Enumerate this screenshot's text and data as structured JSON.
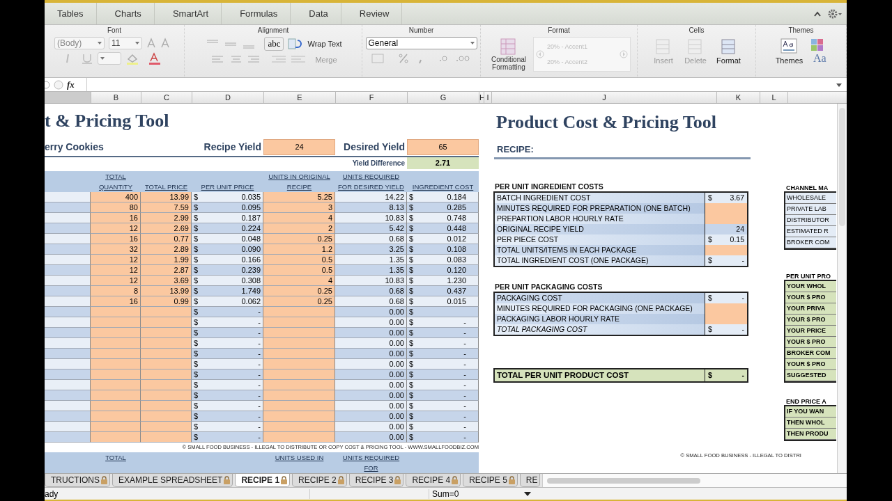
{
  "ribbon": {
    "tabs": [
      "Tables",
      "Charts",
      "SmartArt",
      "Formulas",
      "Data",
      "Review"
    ],
    "font_group": {
      "label": "Font",
      "font_name": "(Body)",
      "font_size": "11"
    },
    "alignment_group": {
      "label": "Alignment",
      "orientation_button": "abc",
      "wrap_text": "Wrap Text",
      "merge": "Merge"
    },
    "number_group": {
      "label": "Number",
      "format": "General"
    },
    "format_group": {
      "label": "Format",
      "conditional_formatting": "Conditional Formatting",
      "styles": [
        "20% - Accent1",
        "20% - Accent2"
      ]
    },
    "cells_group": {
      "label": "Cells",
      "buttons": [
        {
          "label": "Insert",
          "disabled": true
        },
        {
          "label": "Delete",
          "disabled": true
        },
        {
          "label": "Format",
          "disabled": false
        }
      ]
    },
    "themes_group": {
      "label": "Themes",
      "themes_button": "Themes",
      "fonts_button": "Aa"
    }
  },
  "formula_bar": {
    "fx": "fx"
  },
  "column_headers": [
    "B",
    "C",
    "D",
    "E",
    "F",
    "G",
    "H",
    "I",
    "J",
    "K",
    "L"
  ],
  "left_sheet": {
    "title": "t & Pricing Tool",
    "recipe_name": "erry Cookies",
    "recipe_yield_label": "Recipe Yield",
    "recipe_yield": "24",
    "desired_yield_label": "Desired Yield",
    "desired_yield": "65",
    "yield_difference_label": "Yield Difference",
    "yield_difference": "2.71",
    "columns": [
      "TOTAL QUANTITY",
      "TOTAL PRICE",
      "PER UNIT PRICE",
      "UNITS IN ORIGINAL RECIPE",
      "UNITS REQUIRED FOR DESIRED YIELD",
      "INGREDIENT COST"
    ],
    "rows": [
      {
        "total_quantity": "400",
        "total_price": "13.99",
        "per_unit_price": {
          "sign": "$",
          "amount": "0.035"
        },
        "units_original": "5.25",
        "units_required": "14.22",
        "ingredient_cost": {
          "sign": "$",
          "amount": "0.184"
        }
      },
      {
        "total_quantity": "80",
        "total_price": "7.59",
        "per_unit_price": {
          "sign": "$",
          "amount": "0.095"
        },
        "units_original": "3",
        "units_required": "8.13",
        "ingredient_cost": {
          "sign": "$",
          "amount": "0.285"
        }
      },
      {
        "total_quantity": "16",
        "total_price": "2.99",
        "per_unit_price": {
          "sign": "$",
          "amount": "0.187"
        },
        "units_original": "4",
        "units_required": "10.83",
        "ingredient_cost": {
          "sign": "$",
          "amount": "0.748"
        }
      },
      {
        "total_quantity": "12",
        "total_price": "2.69",
        "per_unit_price": {
          "sign": "$",
          "amount": "0.224"
        },
        "units_original": "2",
        "units_required": "5.42",
        "ingredient_cost": {
          "sign": "$",
          "amount": "0.448"
        }
      },
      {
        "total_quantity": "16",
        "total_price": "0.77",
        "per_unit_price": {
          "sign": "$",
          "amount": "0.048"
        },
        "units_original": "0.25",
        "units_required": "0.68",
        "ingredient_cost": {
          "sign": "$",
          "amount": "0.012"
        }
      },
      {
        "total_quantity": "32",
        "total_price": "2.89",
        "per_unit_price": {
          "sign": "$",
          "amount": "0.090"
        },
        "units_original": "1.2",
        "units_required": "3.25",
        "ingredient_cost": {
          "sign": "$",
          "amount": "0.108"
        }
      },
      {
        "total_quantity": "12",
        "total_price": "1.99",
        "per_unit_price": {
          "sign": "$",
          "amount": "0.166"
        },
        "units_original": "0.5",
        "units_required": "1.35",
        "ingredient_cost": {
          "sign": "$",
          "amount": "0.083"
        }
      },
      {
        "total_quantity": "12",
        "total_price": "2.87",
        "per_unit_price": {
          "sign": "$",
          "amount": "0.239"
        },
        "units_original": "0.5",
        "units_required": "1.35",
        "ingredient_cost": {
          "sign": "$",
          "amount": "0.120"
        }
      },
      {
        "total_quantity": "12",
        "total_price": "3.69",
        "per_unit_price": {
          "sign": "$",
          "amount": "0.308"
        },
        "units_original": "4",
        "units_required": "10.83",
        "ingredient_cost": {
          "sign": "$",
          "amount": "1.230"
        }
      },
      {
        "total_quantity": "8",
        "total_price": "13.99",
        "per_unit_price": {
          "sign": "$",
          "amount": "1.749"
        },
        "units_original": "0.25",
        "units_required": "0.68",
        "ingredient_cost": {
          "sign": "$",
          "amount": "0.437"
        }
      },
      {
        "total_quantity": "16",
        "total_price": "0.99",
        "per_unit_price": {
          "sign": "$",
          "amount": "0.062"
        },
        "units_original": "0.25",
        "units_required": "0.68",
        "ingredient_cost": {
          "sign": "$",
          "amount": "0.015"
        }
      },
      {
        "per_unit_price": {
          "sign": "$",
          "amount": "-"
        },
        "units_required": "0.00",
        "ingredient_cost": {
          "sign": "$"
        }
      },
      {
        "per_unit_price": {
          "sign": "$",
          "amount": "-"
        },
        "units_required": "0.00",
        "ingredient_cost": {
          "sign": "$",
          "amount": "-"
        }
      },
      {
        "per_unit_price": {
          "sign": "$",
          "amount": "-"
        },
        "units_required": "0.00",
        "ingredient_cost": {
          "sign": "$",
          "amount": "-"
        }
      },
      {
        "per_unit_price": {
          "sign": "$",
          "amount": "-"
        },
        "units_required": "0.00",
        "ingredient_cost": {
          "sign": "$",
          "amount": "-"
        }
      },
      {
        "per_unit_price": {
          "sign": "$",
          "amount": "-"
        },
        "units_required": "0.00",
        "ingredient_cost": {
          "sign": "$",
          "amount": "-"
        }
      },
      {
        "per_unit_price": {
          "sign": "$",
          "amount": "-"
        },
        "units_required": "0.00",
        "ingredient_cost": {
          "sign": "$",
          "amount": "-"
        }
      },
      {
        "per_unit_price": {
          "sign": "$",
          "amount": "-"
        },
        "units_required": "0.00",
        "ingredient_cost": {
          "sign": "$",
          "amount": "-"
        }
      },
      {
        "per_unit_price": {
          "sign": "$",
          "amount": "-"
        },
        "units_required": "0.00",
        "ingredient_cost": {
          "sign": "$",
          "amount": "-"
        }
      },
      {
        "per_unit_price": {
          "sign": "$",
          "amount": "-"
        },
        "units_required": "0.00",
        "ingredient_cost": {
          "sign": "$",
          "amount": "-"
        }
      },
      {
        "per_unit_price": {
          "sign": "$",
          "amount": "-"
        },
        "units_required": "0.00",
        "ingredient_cost": {
          "sign": "$",
          "amount": "-"
        }
      },
      {
        "per_unit_price": {
          "sign": "$",
          "amount": "-"
        },
        "units_required": "0.00",
        "ingredient_cost": {
          "sign": "$",
          "amount": "-"
        }
      },
      {
        "per_unit_price": {
          "sign": "$",
          "amount": "-"
        },
        "units_required": "0.00",
        "ingredient_cost": {
          "sign": "$",
          "amount": "-"
        }
      },
      {
        "per_unit_price": {
          "sign": "$",
          "amount": "-"
        },
        "units_required": "0.00",
        "ingredient_cost": {
          "sign": "$",
          "amount": "-"
        }
      }
    ],
    "copyright": "© SMALL FOOD BUSINESS - ILLEGAL TO DISTRIBUTE OR COPY COST & PRICING TOOL - WWW.SMALLFOODBIZ.COM",
    "repeat_headers": [
      "TOTAL",
      "UNITS USED IN",
      "UNITS REQUIRED FOR"
    ]
  },
  "right_sheet": {
    "title": "Product Cost & Pricing Tool",
    "recipe_label": "RECIPE:",
    "ingredient_heading": "PER UNIT INGREDIENT COSTS",
    "ingredient_rows": [
      {
        "label": "BATCH INGREDIENT COST",
        "kind": "money",
        "sign": "$",
        "amount": "3.67"
      },
      {
        "label": "MINUTES REQUIRED FOR PREPARATION (ONE BATCH)",
        "kind": "input"
      },
      {
        "label": "PREPARTION LABOR HOURLY RATE",
        "kind": "input"
      },
      {
        "label": "ORIGINAL RECIPE YIELD",
        "kind": "number",
        "amount": "24"
      },
      {
        "label": "PER PIECE COST",
        "kind": "money",
        "sign": "$",
        "amount": "0.15"
      },
      {
        "label": "TOTAL UNITS/ITEMS IN EACH PACKAGE",
        "kind": "input"
      },
      {
        "label": "TOTAL INGREDIENT COST (ONE PACKAGE)",
        "kind": "money",
        "sign": "$",
        "amount": "-"
      }
    ],
    "packaging_heading": "PER UNIT PACKAGING COSTS",
    "packaging_rows": [
      {
        "label": "PACKAGING COST",
        "kind": "money",
        "sign": "$",
        "amount": "-",
        "italic": false
      },
      {
        "label": "MINUTES REQUIRED FOR PACKAGING (ONE PACKAGE)",
        "kind": "input",
        "italic": false
      },
      {
        "label": "PACKAGING LABOR HOURLY RATE",
        "kind": "input",
        "italic": false
      },
      {
        "label": "TOTAL PACKAGING COST",
        "kind": "money",
        "sign": "$",
        "amount": "-",
        "italic": true
      }
    ],
    "total": {
      "label": "TOTAL PER UNIT PRODUCT COST",
      "sign": "$",
      "amount": "-"
    },
    "copyright": "© SMALL FOOD BUSINESS - ILLEGAL TO DISTRI",
    "channel_heading": "CHANNEL MA",
    "channel_rows": [
      "WHOLESALE",
      "PRIVATE LAB",
      "DISTRIBUTOR",
      "ESTIMATED R",
      "BROKER COM"
    ],
    "profit_heading": "PER UNIT PRO",
    "profit_rows": [
      "YOUR WHOL",
      "YOUR $ PRO",
      "YOUR PRIVA",
      "YOUR $ PRO",
      "YOUR PRICE",
      "YOUR $ PRO",
      "BROKER COM",
      "YOUR $ PRO",
      "SUGGESTED"
    ],
    "end_heading": "END PRICE A",
    "end_rows": [
      "IF YOU WAN",
      "THEN WHOL",
      "THEN PRODU"
    ]
  },
  "sheet_tabs": [
    {
      "label": "TRUCTIONS",
      "selected": false,
      "locked": true
    },
    {
      "label": "EXAMPLE SPREADSHEET",
      "selected": false,
      "locked": true
    },
    {
      "label": "RECIPE 1",
      "selected": true,
      "locked": true
    },
    {
      "label": "RECIPE 2",
      "selected": false,
      "locked": true
    },
    {
      "label": "RECIPE 3",
      "selected": false,
      "locked": true
    },
    {
      "label": "RECIPE 4",
      "selected": false,
      "locked": true
    },
    {
      "label": "RECIPE 5",
      "selected": false,
      "locked": true
    },
    {
      "label": "RE",
      "selected": false,
      "locked": false
    }
  ],
  "status_bar": {
    "mode": "ady",
    "sum": "Sum=0"
  }
}
